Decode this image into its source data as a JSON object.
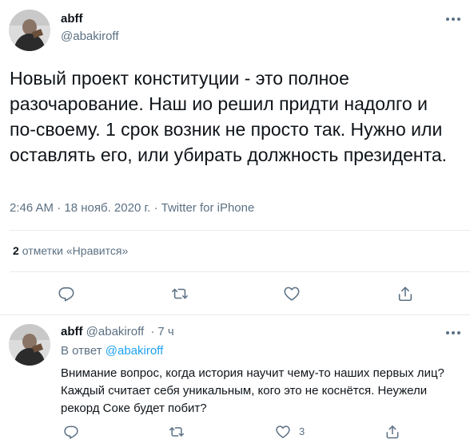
{
  "tweet": {
    "author": {
      "display_name": "abff",
      "handle": "@abakiroff",
      "avatar_icon": "user-avatar"
    },
    "text": "Новый проект конституции - это полное разочарование. Наш ио решил придти надолго и по-своему. 1 срок возник не просто так. Нужно или оставлять его, или убирать должность президента.",
    "time": "2:46 AM",
    "date": "18 нояб. 2020 г.",
    "separator": "·",
    "source": "Twitter for iPhone",
    "likes": {
      "count": "2",
      "label": "отметки «Нравится»"
    },
    "actions": [
      "reply-icon",
      "retweet-icon",
      "like-icon",
      "share-icon"
    ]
  },
  "reply": {
    "author": {
      "display_name": "abff",
      "handle": "@abakiroff",
      "avatar_icon": "user-avatar"
    },
    "dot": "·",
    "time": "7 ч",
    "reply_to_label": "В ответ",
    "reply_to_handle": "@abakiroff",
    "text": "Внимание вопрос, когда история научит чему-то наших первых лиц? Каждый считает себя уникальным, кого это не коснётся. Неужели рекорд Соке будет побит?",
    "like_count": "3",
    "actions": [
      "reply-icon",
      "retweet-icon",
      "like-icon",
      "share-icon"
    ]
  },
  "colors": {
    "text": "#0f1419",
    "secondary": "#5b7083",
    "link": "#1da1f2",
    "divider": "#e6ecf0",
    "icon": "#5b7083"
  }
}
